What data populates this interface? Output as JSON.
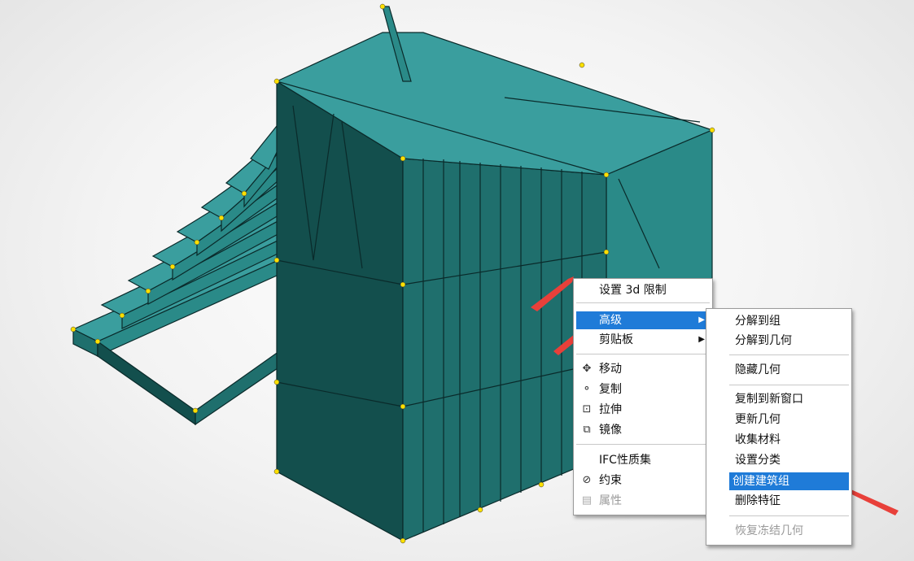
{
  "context_menu": {
    "items": [
      {
        "label": "设置 3d 限制",
        "icon": "",
        "state": "normal",
        "submenu": false
      },
      {
        "label": "高级",
        "icon": "",
        "state": "selected",
        "submenu": true
      },
      {
        "label": "剪贴板",
        "icon": "",
        "state": "normal",
        "submenu": true
      },
      {
        "label": "移动",
        "icon": "move-icon",
        "glyph": "✥",
        "state": "normal",
        "submenu": false
      },
      {
        "label": "复制",
        "icon": "copy-icon",
        "glyph": "⚬",
        "state": "normal",
        "submenu": false
      },
      {
        "label": "拉伸",
        "icon": "stretch-icon",
        "glyph": "⊡",
        "state": "normal",
        "submenu": false
      },
      {
        "label": "镜像",
        "icon": "mirror-icon",
        "glyph": "⧉",
        "state": "normal",
        "submenu": false
      },
      {
        "label": "IFC性质集",
        "icon": "",
        "state": "normal",
        "submenu": false
      },
      {
        "label": "约束",
        "icon": "constraint-icon",
        "glyph": "⊘",
        "state": "normal",
        "submenu": false
      },
      {
        "label": "属性",
        "icon": "properties-icon",
        "glyph": "▤",
        "state": "disabled",
        "submenu": false
      }
    ]
  },
  "advanced_submenu": {
    "items": [
      {
        "label": "分解到组",
        "state": "normal"
      },
      {
        "label": "分解到几何",
        "state": "normal"
      },
      {
        "label": "隐藏几何",
        "state": "normal"
      },
      {
        "label": "复制到新窗口",
        "state": "normal"
      },
      {
        "label": "更新几何",
        "state": "normal"
      },
      {
        "label": "收集材料",
        "state": "normal"
      },
      {
        "label": "设置分类",
        "state": "normal"
      },
      {
        "label": "创建建筑组",
        "state": "selected"
      },
      {
        "label": "删除特征",
        "state": "normal"
      },
      {
        "label": "恢复冻结几何",
        "state": "disabled"
      }
    ]
  },
  "colors": {
    "model_top": "#3a9e9e",
    "model_front": "#1f6f6d",
    "model_side": "#2a8a88",
    "model_dark": "#134f4d",
    "edge": "#0a2a2a",
    "node": "#ffe000",
    "highlight": "#1f7bd8",
    "annotation_arrow": "#e8403a"
  }
}
